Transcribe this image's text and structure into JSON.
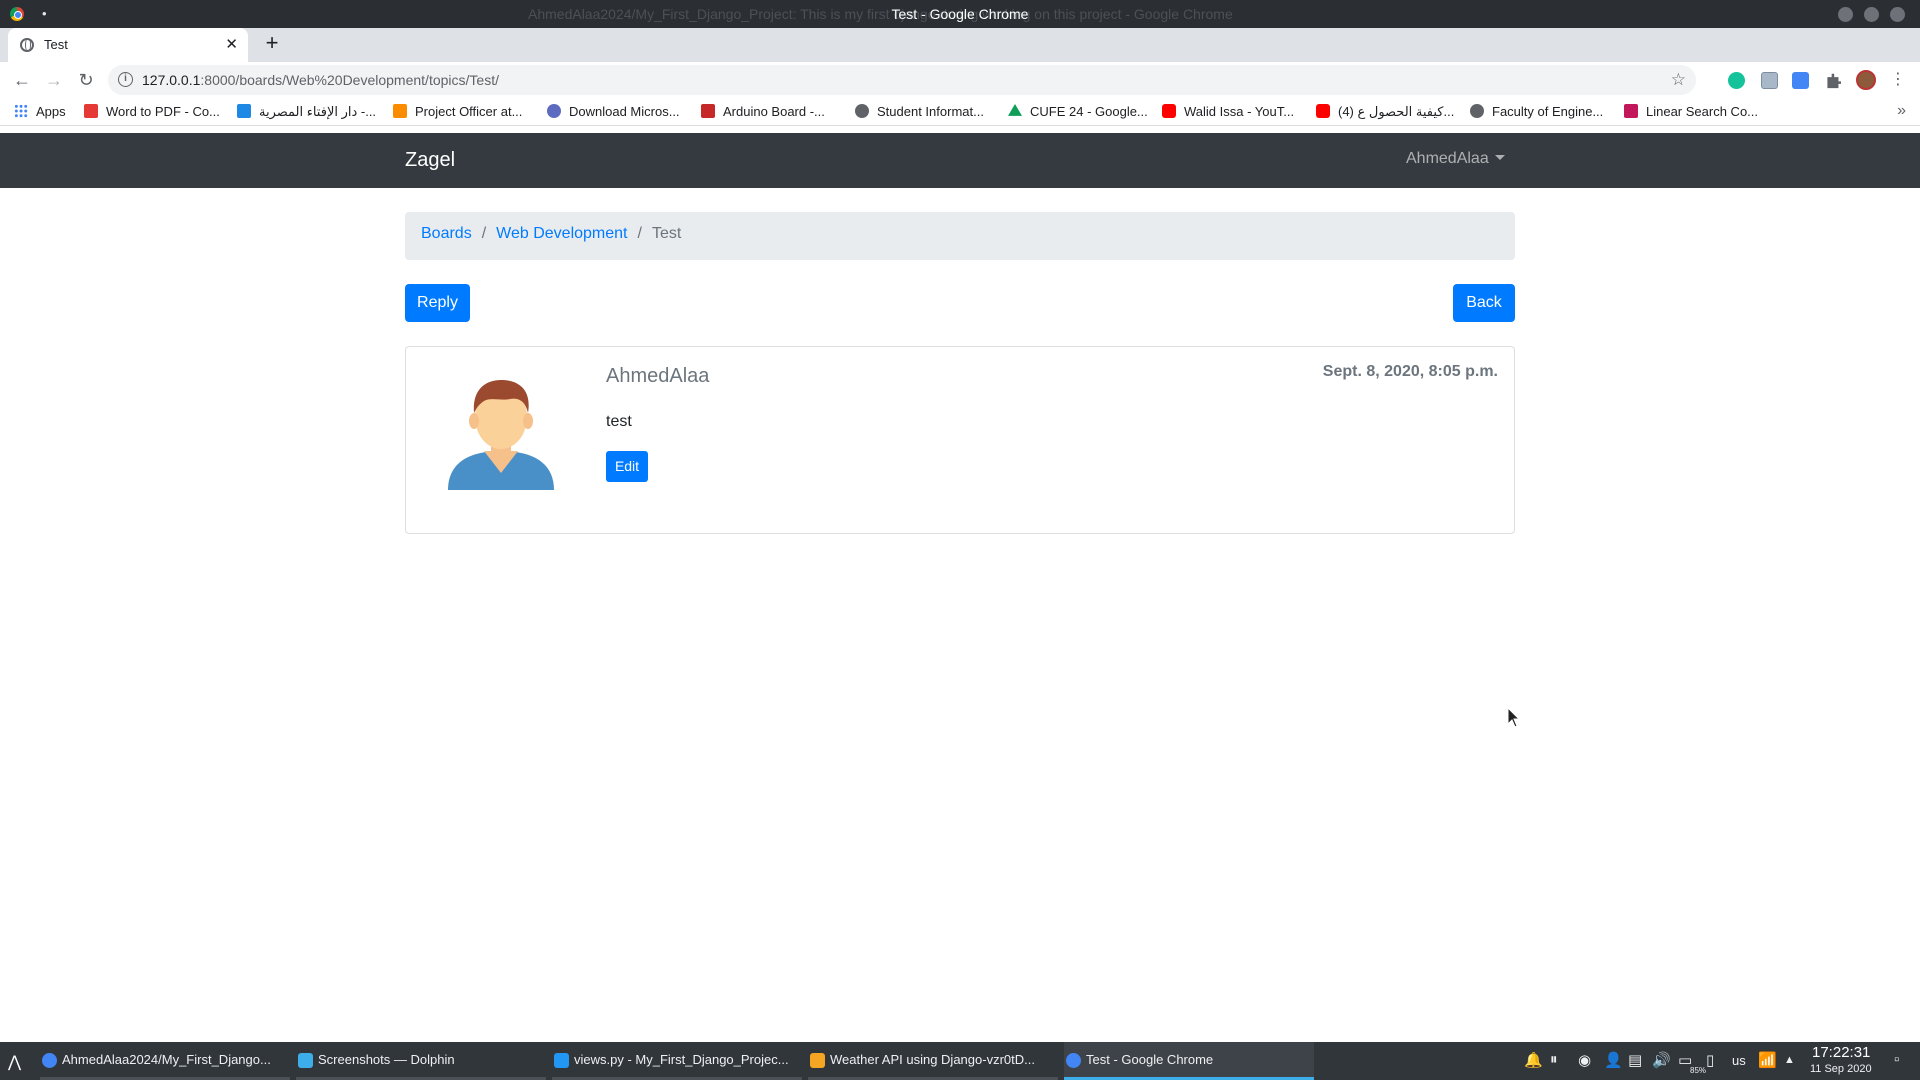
{
  "window": {
    "title": "Test - Google Chrome",
    "ghost_title": "AhmedAlaa2024/My_First_Django_Project: This is my first        django during working on this project - Google Chrome",
    "dot": "•"
  },
  "tab": {
    "title": "Test",
    "close": "✕",
    "new_tab": "+"
  },
  "toolbar": {
    "back": "←",
    "forward": "→",
    "reload": "↻",
    "url_host": "127.0.0.1",
    "url_rest": ":8000/boards/Web%20Development/topics/Test/",
    "info": "i",
    "star": "☆",
    "extension_icons": [
      "grammarly-icon",
      "image-extension-icon",
      "translate-icon",
      "puzzle-icon",
      "profile-avatar-icon"
    ],
    "menu": "⋮"
  },
  "bookmarks": {
    "items": [
      {
        "label": "Apps",
        "icon": "apps-grid-icon"
      },
      {
        "label": "Word to PDF - Co...",
        "icon": "word-to-pdf-icon",
        "color": "#e53935"
      },
      {
        "label": "دار الإفتاء المصرية -...",
        "icon": "dar-alifta-icon",
        "color": "#1e88e5"
      },
      {
        "label": "Project Officer at...",
        "icon": "project-officer-icon",
        "color": "#fb8c00"
      },
      {
        "label": "Download Micros...",
        "icon": "microsoft-download-icon",
        "color": "#5c6bc0"
      },
      {
        "label": "Arduino Board -...",
        "icon": "arduino-icon",
        "color": "#c62828"
      },
      {
        "label": "Student Informat...",
        "icon": "globe-icon",
        "color": "#5f6368"
      },
      {
        "label": "CUFE 24 - Google...",
        "icon": "google-drive-icon",
        "color": "#0f9d58"
      },
      {
        "label": "Walid Issa - YouT...",
        "icon": "youtube-icon",
        "color": "#ff0000"
      },
      {
        "label": "(4) كيفية الحصول ع...",
        "icon": "youtube-icon",
        "color": "#ff0000"
      },
      {
        "label": "Faculty of Engine...",
        "icon": "globe-icon",
        "color": "#5f6368"
      },
      {
        "label": "Linear Search Co...",
        "icon": "edx-icon",
        "color": "#c2185b"
      }
    ],
    "more": "»"
  },
  "site": {
    "brand": "Zagel",
    "user": "AhmedAlaa",
    "breadcrumb": {
      "boards": "Boards",
      "board": "Web Development",
      "topic": "Test",
      "sep": "/"
    },
    "reply_label": "Reply",
    "back_label": "Back",
    "post": {
      "author": "AhmedAlaa",
      "date": "Sept. 8, 2020, 8:05 p.m.",
      "message": "test",
      "edit_label": "Edit"
    }
  },
  "taskbar": {
    "launcher": "⋀",
    "tasks": [
      {
        "label": "AhmedAlaa2024/My_First_Django...",
        "icon": "chrome-icon",
        "color": "#4285f4"
      },
      {
        "label": "Screenshots — Dolphin",
        "icon": "dolphin-folder-icon",
        "color": "#3daee9"
      },
      {
        "label": "views.py - My_First_Django_Projec...",
        "icon": "vscode-icon",
        "color": "#2196f3"
      },
      {
        "label": "Weather API using Django-vzr0tD...",
        "icon": "video-player-icon",
        "color": "#f5a623"
      },
      {
        "label": "Test - Google Chrome",
        "icon": "chrome-icon",
        "color": "#4285f4"
      }
    ],
    "keyboard_layout": "us",
    "battery": "85%",
    "time": "17:22:31",
    "date": "11 Sep 2020"
  }
}
